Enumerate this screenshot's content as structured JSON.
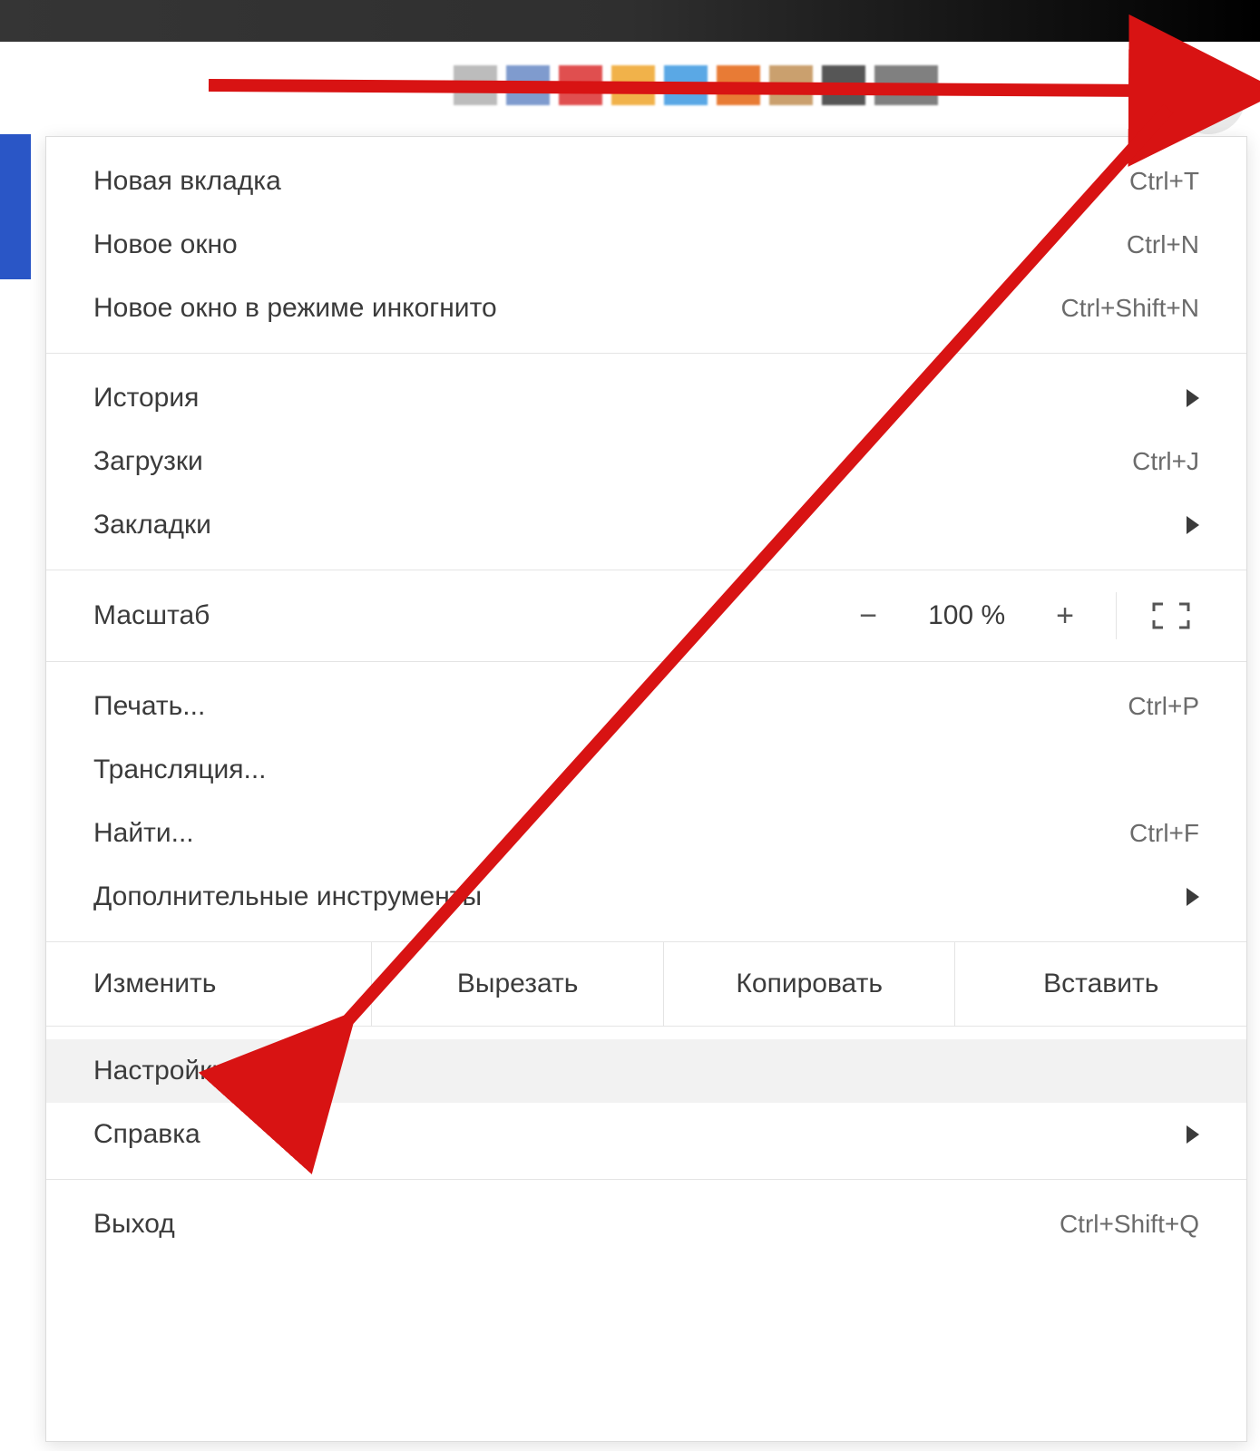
{
  "swatches": [
    "#bcbcbc",
    "#7f9bce",
    "#e04f4f",
    "#f1b24a",
    "#5aa8e5",
    "#e87b35",
    "#caa06e",
    "#565656",
    "#808080"
  ],
  "menu": {
    "group1": {
      "new_tab": {
        "label": "Новая вкладка",
        "shortcut": "Ctrl+T"
      },
      "new_window": {
        "label": "Новое окно",
        "shortcut": "Ctrl+N"
      },
      "new_incognito": {
        "label": "Новое окно в режиме инкогнито",
        "shortcut": "Ctrl+Shift+N"
      }
    },
    "group2": {
      "history": {
        "label": "История",
        "submenu": true
      },
      "downloads": {
        "label": "Загрузки",
        "shortcut": "Ctrl+J"
      },
      "bookmarks": {
        "label": "Закладки",
        "submenu": true
      }
    },
    "zoom": {
      "label": "Масштаб",
      "minus": "−",
      "value": "100 %",
      "plus": "+"
    },
    "group4": {
      "print": {
        "label": "Печать...",
        "shortcut": "Ctrl+P"
      },
      "cast": {
        "label": "Трансляция..."
      },
      "find": {
        "label": "Найти...",
        "shortcut": "Ctrl+F"
      },
      "tools": {
        "label": "Дополнительные инструменты",
        "submenu": true
      }
    },
    "edit_row": {
      "label": "Изменить",
      "cut": "Вырезать",
      "copy": "Копировать",
      "paste": "Вставить"
    },
    "group6": {
      "settings": {
        "label": "Настройки"
      },
      "help": {
        "label": "Справка",
        "submenu": true
      }
    },
    "group7": {
      "exit": {
        "label": "Выход",
        "shortcut": "Ctrl+Shift+Q"
      }
    }
  }
}
